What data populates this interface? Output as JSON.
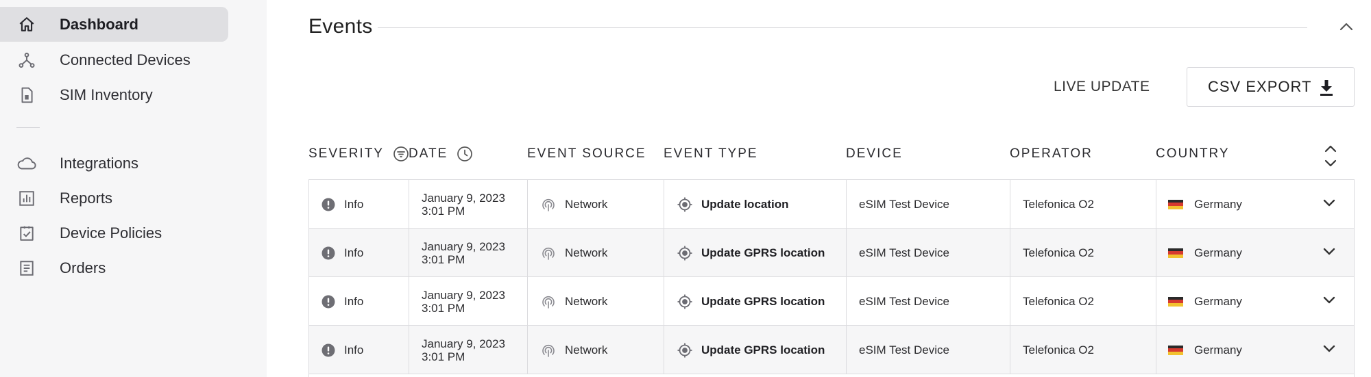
{
  "sidebar": {
    "items": [
      {
        "label": "Dashboard",
        "icon": "home-icon",
        "active": true
      },
      {
        "label": "Connected Devices",
        "icon": "network-icon",
        "active": false
      },
      {
        "label": "SIM Inventory",
        "icon": "sim-card-icon",
        "active": false
      },
      {
        "label": "Integrations",
        "icon": "cloud-icon",
        "active": false
      },
      {
        "label": "Reports",
        "icon": "bar-chart-icon",
        "active": false
      },
      {
        "label": "Device Policies",
        "icon": "checklist-icon",
        "active": false
      },
      {
        "label": "Orders",
        "icon": "receipt-icon",
        "active": false
      }
    ]
  },
  "events": {
    "title": "Events",
    "live_update_label": "LIVE UPDATE",
    "csv_export_label": "CSV EXPORT",
    "columns": {
      "severity": "SEVERITY",
      "date": "DATE",
      "event_source": "EVENT SOURCE",
      "event_type": "EVENT TYPE",
      "device": "DEVICE",
      "operator": "OPERATOR",
      "country": "COUNTRY"
    },
    "rows": [
      {
        "severity": "Info",
        "date_line1": "January 9, 2023",
        "date_line2": "3:01 PM",
        "source": "Network",
        "type": "Update location",
        "device": "eSIM Test Device",
        "operator": "Telefonica O2",
        "country": "Germany"
      },
      {
        "severity": "Info",
        "date_line1": "January 9, 2023",
        "date_line2": "3:01 PM",
        "source": "Network",
        "type": "Update GPRS location",
        "device": "eSIM Test Device",
        "operator": "Telefonica O2",
        "country": "Germany"
      },
      {
        "severity": "Info",
        "date_line1": "January 9, 2023",
        "date_line2": "3:01 PM",
        "source": "Network",
        "type": "Update GPRS location",
        "device": "eSIM Test Device",
        "operator": "Telefonica O2",
        "country": "Germany"
      },
      {
        "severity": "Info",
        "date_line1": "January 9, 2023",
        "date_line2": "3:01 PM",
        "source": "Network",
        "type": "Update GPRS location",
        "device": "eSIM Test Device",
        "operator": "Telefonica O2",
        "country": "Germany"
      }
    ]
  },
  "colors": {
    "sidebar_bg": "#f6f6f7",
    "active_bg": "#dfdfe2",
    "icon_gray": "#6b6b72",
    "border": "#dcdcdf",
    "flag_black": "#2a2a2a",
    "flag_red": "#d63a2f",
    "flag_gold": "#f2c230"
  }
}
